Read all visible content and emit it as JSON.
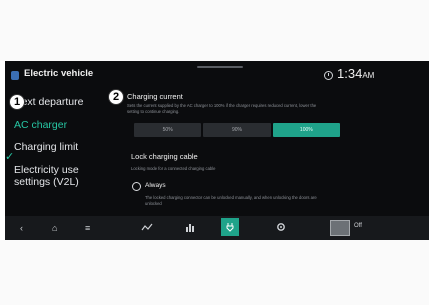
{
  "header": {
    "app_icon": "ev-icon",
    "title": "Electric vehicle",
    "status_icon": "clock-status-icon",
    "time": "1:34",
    "ampm": "AM"
  },
  "sidebar": {
    "items": [
      {
        "label": "Next departure",
        "active": false
      },
      {
        "label": "AC charger",
        "active": true
      },
      {
        "label": "Charging limit",
        "active": false
      },
      {
        "label": "Electricity use",
        "active": false
      },
      {
        "label": "settings (V2L)",
        "active": false
      }
    ],
    "active_marker": "✓"
  },
  "callouts": {
    "one": "1",
    "two": "2"
  },
  "charging_current": {
    "title": "Charging current",
    "description_line1": "Sets the current supplied by the AC charger to 100% if the charger requires reduced current, lower the",
    "description_line2": "setting to continue charging.",
    "options": [
      "50%",
      "90%",
      "100%"
    ],
    "selected_index": 2
  },
  "lock_cable": {
    "title": "Lock charging cable",
    "description": "Locking mode for a connected charging cable",
    "option_label": "Always",
    "option_desc_line1": "The locked charging connector can be unlocked manually, and when unlocking the doors are",
    "option_desc_line2": "unlocked"
  },
  "navbar": {
    "back_icon": "‹",
    "home_icon": "⌂",
    "menu_icon": "≡",
    "off_label": "Off"
  },
  "colors": {
    "accent": "#1fa38a",
    "active_text": "#27c7a4",
    "background": "#0b0c0e"
  }
}
